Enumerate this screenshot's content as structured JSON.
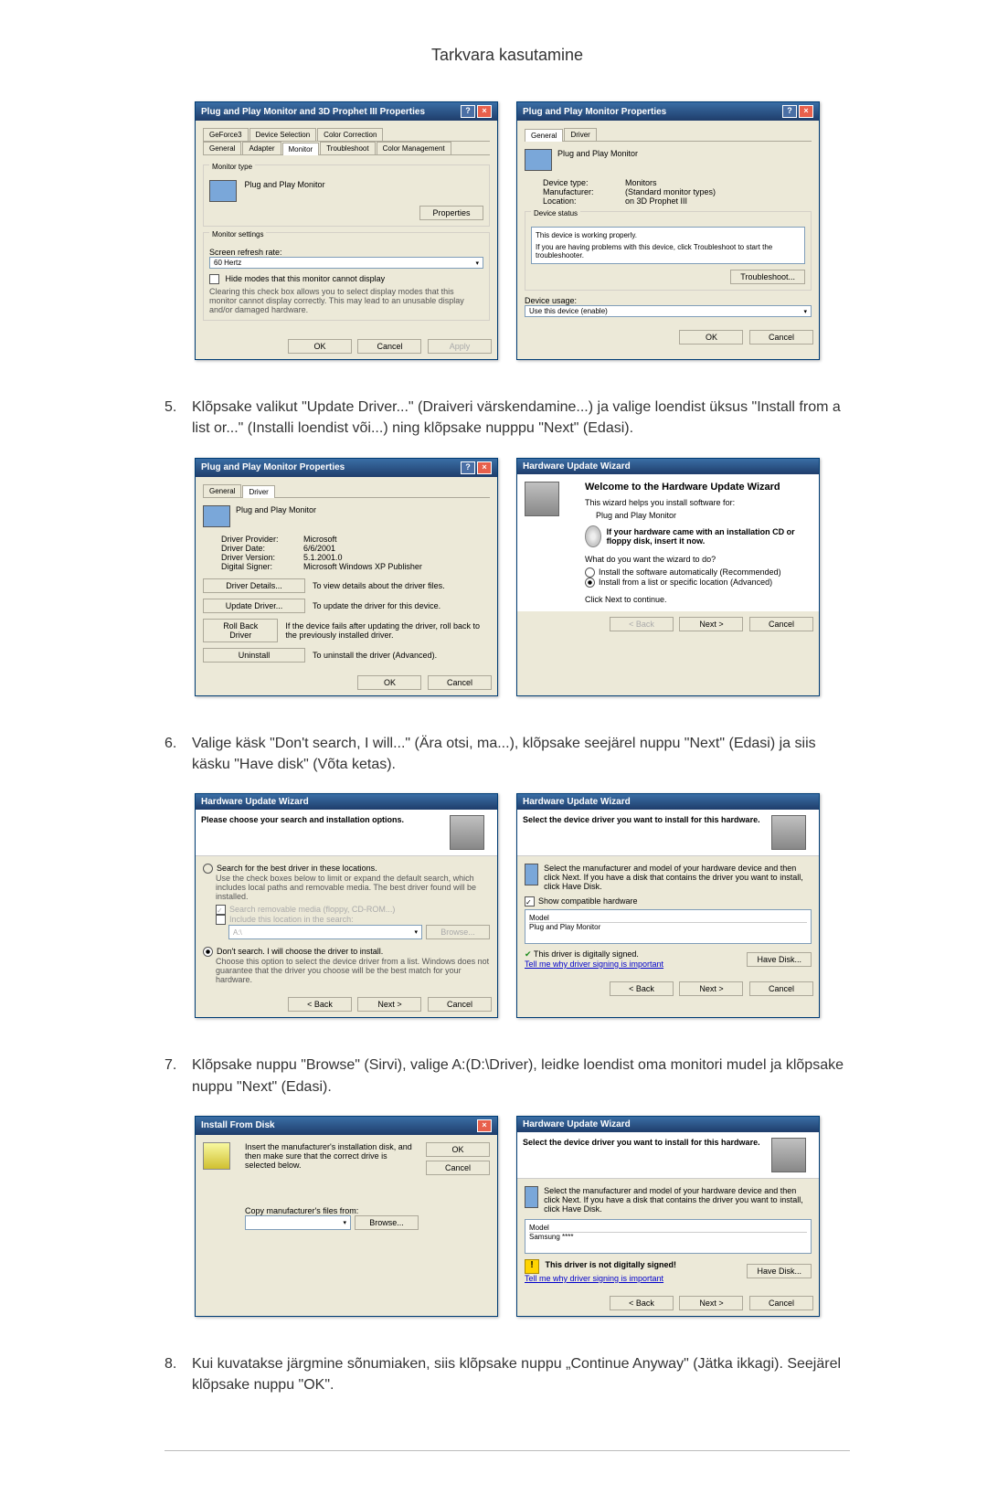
{
  "page_title": "Tarkvara kasutamine",
  "steps": {
    "s5": {
      "num": "5.",
      "text": "Klõpsake valikut \"Update Driver...\" (Draiveri värskendamine...) ja valige loendist üksus \"Install from a list or...\" (Installi loendist või...) ning klõpsake nupppu \"Next\" (Edasi)."
    },
    "s6": {
      "num": "6.",
      "text": "Valige käsk \"Don't search, I will...\" (Ära otsi, ma...), klõpsake seejärel nuppu \"Next\" (Edasi) ja siis käsku \"Have disk\" (Võta ketas)."
    },
    "s7": {
      "num": "7.",
      "text": "Klõpsake nuppu \"Browse\" (Sirvi), valige A:(D:\\Driver), leidke loendist oma monitori mudel ja klõpsake nuppu \"Next\" (Edasi)."
    },
    "s8": {
      "num": "8.",
      "text": "Kui kuvatakse järgmine sõnumiaken, siis klõpsake nuppu „Continue Anyway\" (Jätka ikkagi). Seejärel klõpsake nuppu \"OK\"."
    }
  },
  "common": {
    "ok": "OK",
    "cancel": "Cancel",
    "apply": "Apply",
    "back": "< Back",
    "next": "Next >",
    "browse": "Browse...",
    "have_disk": "Have Disk..."
  },
  "dlg_settings": {
    "title": "Plug and Play Monitor and 3D Prophet III Properties",
    "tabs_row1": [
      "GeForce3",
      "Device Selection",
      "Color Correction"
    ],
    "tabs_row2": [
      "General",
      "Adapter",
      "Monitor",
      "Troubleshoot",
      "Color Management"
    ],
    "monitor_type_label": "Monitor type",
    "monitor_type_value": "Plug and Play Monitor",
    "properties_btn": "Properties",
    "monitor_settings_label": "Monitor settings",
    "refresh_label": "Screen refresh rate:",
    "refresh_value": "60 Hertz",
    "hide_modes": "Hide modes that this monitor cannot display",
    "hide_modes_desc": "Clearing this check box allows you to select display modes that this monitor cannot display correctly. This may lead to an unusable display and/or damaged hardware."
  },
  "dlg_devprops": {
    "title": "Plug and Play Monitor Properties",
    "tabs": [
      "General",
      "Driver"
    ],
    "heading": "Plug and Play Monitor",
    "rows": [
      [
        "Device type:",
        "Monitors"
      ],
      [
        "Manufacturer:",
        "(Standard monitor types)"
      ],
      [
        "Location:",
        "on 3D Prophet III"
      ]
    ],
    "status_label": "Device status",
    "status_text": "This device is working properly.",
    "status_text2": "If you are having problems with this device, click Troubleshoot to start the troubleshooter.",
    "troubleshoot_btn": "Troubleshoot...",
    "usage_label": "Device usage:",
    "usage_value": "Use this device (enable)"
  },
  "dlg_driver": {
    "title": "Plug and Play Monitor Properties",
    "tabs": [
      "General",
      "Driver"
    ],
    "heading": "Plug and Play Monitor",
    "rows": [
      [
        "Driver Provider:",
        "Microsoft"
      ],
      [
        "Driver Date:",
        "6/6/2001"
      ],
      [
        "Driver Version:",
        "5.1.2001.0"
      ],
      [
        "Digital Signer:",
        "Microsoft Windows XP Publisher"
      ]
    ],
    "btns": {
      "details": {
        "label": "Driver Details...",
        "desc": "To view details about the driver files."
      },
      "update": {
        "label": "Update Driver...",
        "desc": "To update the driver for this device."
      },
      "rollback": {
        "label": "Roll Back Driver",
        "desc": "If the device fails after updating the driver, roll back to the previously installed driver."
      },
      "uninstall": {
        "label": "Uninstall",
        "desc": "To uninstall the driver (Advanced)."
      }
    }
  },
  "wiz_welcome": {
    "title": "Hardware Update Wizard",
    "headline": "Welcome to the Hardware Update Wizard",
    "line1": "This wizard helps you install software for:",
    "line2": "Plug and Play Monitor",
    "cd_hint": "If your hardware came with an installation CD or floppy disk, insert it now.",
    "question": "What do you want the wizard to do?",
    "opt1": "Install the software automatically (Recommended)",
    "opt2": "Install from a list or specific location (Advanced)",
    "cta": "Click Next to continue."
  },
  "wiz_options": {
    "title": "Hardware Update Wizard",
    "headline": "Please choose your search and installation options.",
    "opt_search": "Search for the best driver in these locations.",
    "opt_search_desc": "Use the check boxes below to limit or expand the default search, which includes local paths and removable media. The best driver found will be installed.",
    "chk_removable": "Search removable media (floppy, CD-ROM...)",
    "chk_include": "Include this location in the search:",
    "path": "A:\\",
    "opt_dont": "Don't search. I will choose the driver to install.",
    "opt_dont_desc": "Choose this option to select the device driver from a list. Windows does not guarantee that the driver you choose will be the best match for your hardware."
  },
  "wiz_select1": {
    "title": "Hardware Update Wizard",
    "headline": "Select the device driver you want to install for this hardware.",
    "instr": "Select the manufacturer and model of your hardware device and then click Next. If you have a disk that contains the driver you want to install, click Have Disk.",
    "show_comp": "Show compatible hardware",
    "model_label": "Model",
    "model_value": "Plug and Play Monitor",
    "signed_msg": "This driver is digitally signed.",
    "tell_me": "Tell me why driver signing is important"
  },
  "dlg_installdisk": {
    "title": "Install From Disk",
    "instr": "Insert the manufacturer's installation disk, and then make sure that the correct drive is selected below.",
    "copy_label": "Copy manufacturer's files from:"
  },
  "wiz_select2": {
    "title": "Hardware Update Wizard",
    "headline": "Select the device driver you want to install for this hardware.",
    "instr": "Select the manufacturer and model of your hardware device and then click Next. If you have a disk that contains the driver you want to install, click Have Disk.",
    "model_label": "Model",
    "model_value": "Samsung ****",
    "not_signed": "This driver is not digitally signed!",
    "tell_me": "Tell me why driver signing is important"
  }
}
